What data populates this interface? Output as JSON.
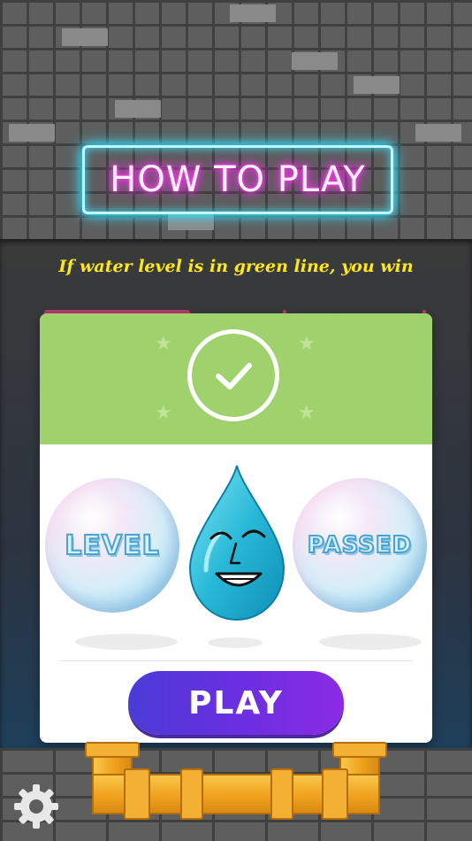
{
  "header": {
    "title": "HOW TO PLAY"
  },
  "instructions": {
    "hint": "If water level is in green line, you win"
  },
  "result_card": {
    "status": "level-passed",
    "left_bubble": "LEVEL",
    "right_bubble": "PASSED",
    "play_label": "PLAY"
  },
  "icons": {
    "success": "check-circle-icon",
    "mascot": "water-drop-mascot",
    "settings": "gear-icon"
  },
  "colors": {
    "neon_border": "#36e0ff",
    "neon_text": "#ff3df0",
    "hint_text": "#ffe81a",
    "card_header": "#9fd16c",
    "play_gradient_start": "#4a3bd6",
    "play_gradient_end": "#8b2be6",
    "pipe": "#f0a21e"
  }
}
